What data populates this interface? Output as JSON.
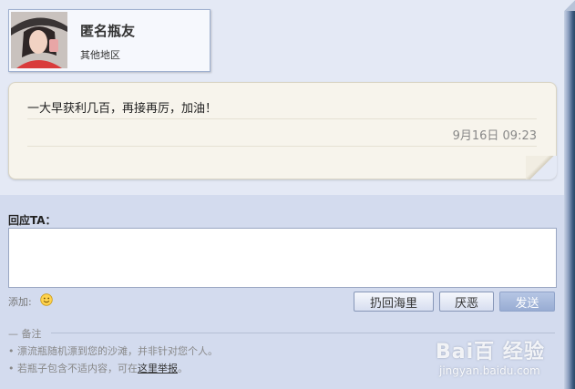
{
  "profile": {
    "name": "匿名瓶友",
    "region": "其他地区",
    "avatar_icon": "user-photo"
  },
  "message": {
    "text": "一大早获利几百，再接再厉，加油！",
    "time": "9月16日 09:23"
  },
  "reply": {
    "label": "回应TA：",
    "input_value": "",
    "add_label": "添加:",
    "emoji_icon": "smiley-emoji-icon"
  },
  "buttons": {
    "throw_back": "扔回海里",
    "dislike": "厌恶",
    "send": "发送"
  },
  "notes": {
    "title": "— 备注",
    "items": [
      "• 漂流瓶随机漂到您的沙滩，并非针对您个人。",
      "• 若瓶子包含不适内容，可在"
    ],
    "report_link": "这里举报",
    "end_punct": "。"
  },
  "watermark": {
    "brand": "Bai百 经验",
    "url": "jingyan.baidu.com"
  },
  "colors": {
    "accent": "#98acd3",
    "bubble": "#f7f4ec",
    "panel": "#d3dbee"
  }
}
